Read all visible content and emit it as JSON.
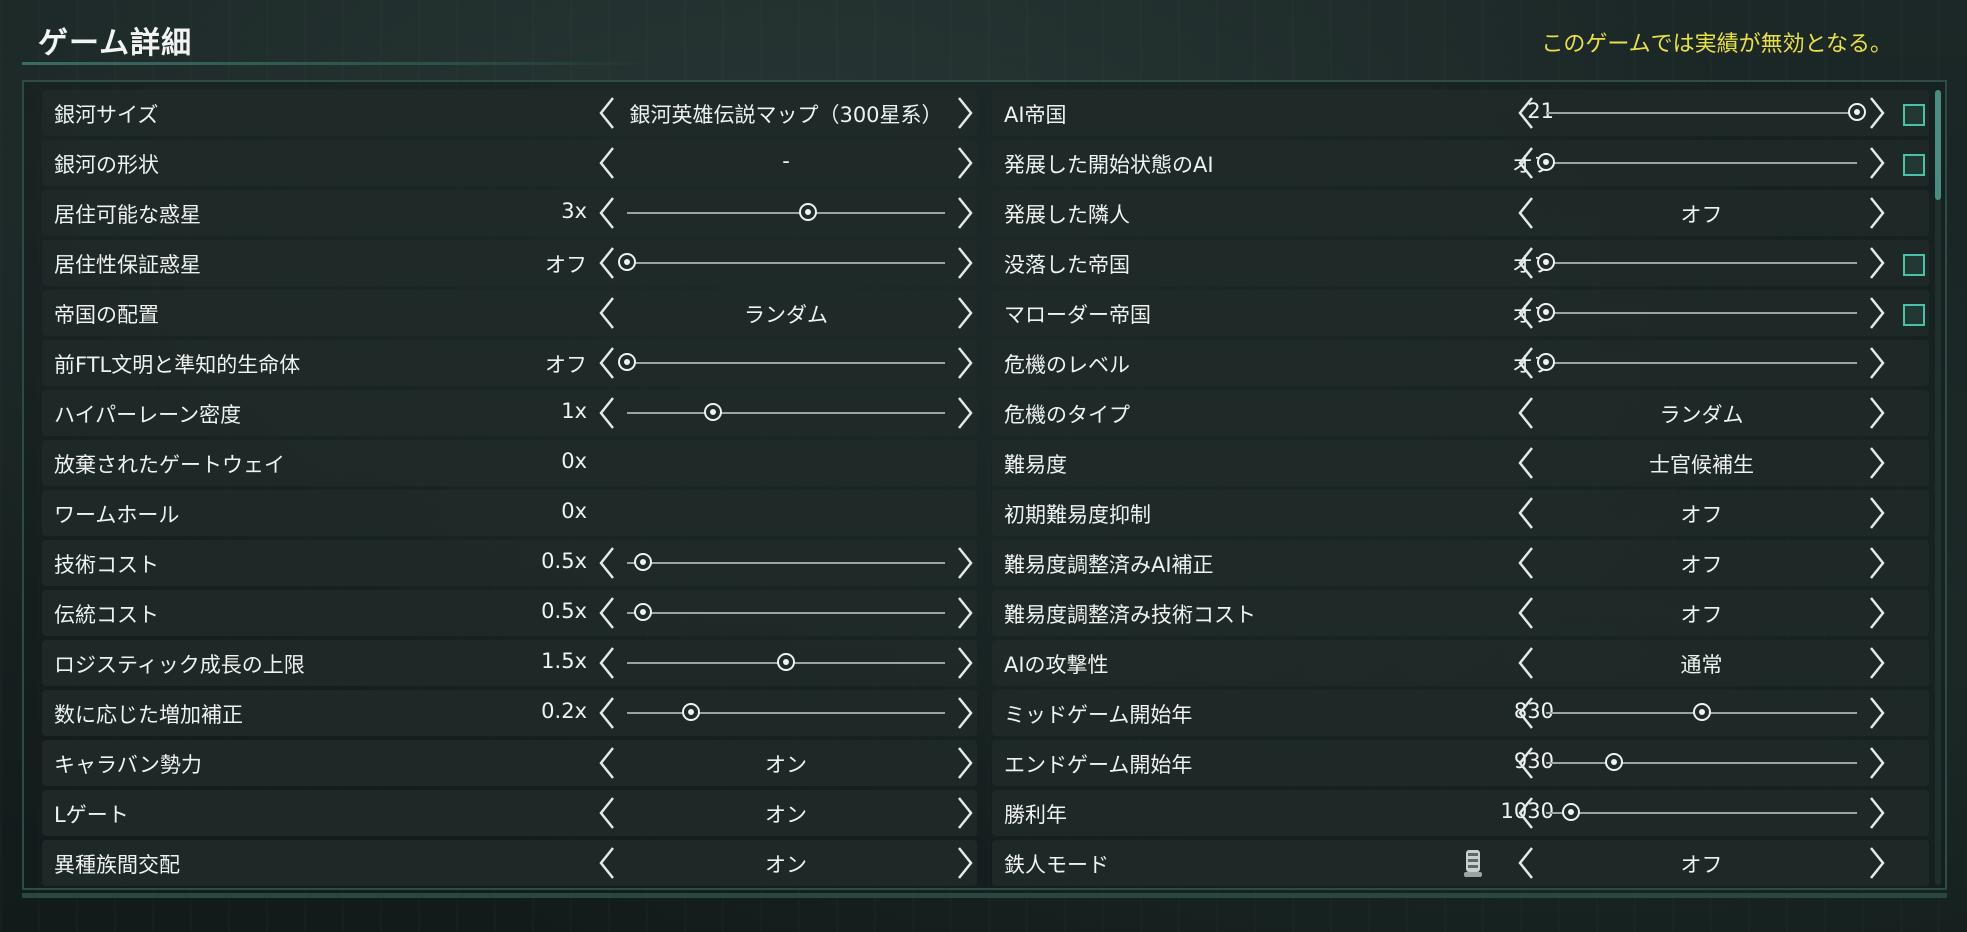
{
  "header": {
    "title": "ゲーム詳細",
    "achievement_notice": "このゲームでは実績が無効となる。"
  },
  "colors": {
    "accent": "#49c2a8",
    "notice": "#e8e04a",
    "row_bg": "#202a29"
  },
  "left": [
    {
      "label": "銀河サイズ",
      "type": "select",
      "value": "銀河英雄伝説マップ（300星系）"
    },
    {
      "label": "銀河の形状",
      "type": "select",
      "value": "-"
    },
    {
      "label": "居住可能な惑星",
      "type": "slider",
      "value": "3x",
      "level": 0.57
    },
    {
      "label": "居住性保証惑星",
      "type": "slider",
      "value": "オフ",
      "level": 0.0
    },
    {
      "label": "帝国の配置",
      "type": "select",
      "value": "ランダム"
    },
    {
      "label": "前FTL文明と準知的生命体",
      "type": "slider",
      "value": "オフ",
      "level": 0.0
    },
    {
      "label": "ハイパーレーン密度",
      "type": "slider",
      "value": "1x",
      "level": 0.27
    },
    {
      "label": "放棄されたゲートウェイ",
      "type": "static",
      "value": "0x"
    },
    {
      "label": "ワームホール",
      "type": "static",
      "value": "0x"
    },
    {
      "label": "技術コスト",
      "type": "slider",
      "value": "0.5x",
      "level": 0.05
    },
    {
      "label": "伝統コスト",
      "type": "slider",
      "value": "0.5x",
      "level": 0.05
    },
    {
      "label": "ロジスティック成長の上限",
      "type": "slider",
      "value": "1.5x",
      "level": 0.5
    },
    {
      "label": "数に応じた増加補正",
      "type": "slider",
      "value": "0.2x",
      "level": 0.2
    },
    {
      "label": "キャラバン勢力",
      "type": "select",
      "value": "オン"
    },
    {
      "label": "Lゲート",
      "type": "select",
      "value": "オン"
    },
    {
      "label": "異種族間交配",
      "type": "select",
      "value": "オン"
    }
  ],
  "right": [
    {
      "label": "AI帝国",
      "type": "slider",
      "value": "21",
      "level": 1.0,
      "checkbox": true
    },
    {
      "label": "発展した開始状態のAI",
      "type": "slider",
      "value": "オフ",
      "level": 0.0,
      "checkbox": true
    },
    {
      "label": "発展した隣人",
      "type": "select",
      "value": "オフ"
    },
    {
      "label": "没落した帝国",
      "type": "slider",
      "value": "オフ",
      "level": 0.0,
      "checkbox": true
    },
    {
      "label": "マローダー帝国",
      "type": "slider",
      "value": "オフ",
      "level": 0.0,
      "checkbox": true
    },
    {
      "label": "危機のレベル",
      "type": "slider",
      "value": "オフ",
      "level": 0.0
    },
    {
      "label": "危機のタイプ",
      "type": "select",
      "value": "ランダム"
    },
    {
      "label": "難易度",
      "type": "select",
      "value": "士官候補生"
    },
    {
      "label": "初期難易度抑制",
      "type": "select",
      "value": "オフ"
    },
    {
      "label": "難易度調整済みAI補正",
      "type": "select",
      "value": "オフ"
    },
    {
      "label": "難易度調整済み技術コスト",
      "type": "select",
      "value": "オフ"
    },
    {
      "label": "AIの攻撃性",
      "type": "select",
      "value": "通常"
    },
    {
      "label": "ミッドゲーム開始年",
      "type": "slider",
      "value": "830",
      "level": 0.5
    },
    {
      "label": "エンドゲーム開始年",
      "type": "slider",
      "value": "930",
      "level": 0.22
    },
    {
      "label": "勝利年",
      "type": "slider",
      "value": "1030",
      "level": 0.08
    },
    {
      "label": "鉄人モード",
      "type": "select",
      "value": "オフ",
      "icon": "ironman-icon"
    }
  ]
}
